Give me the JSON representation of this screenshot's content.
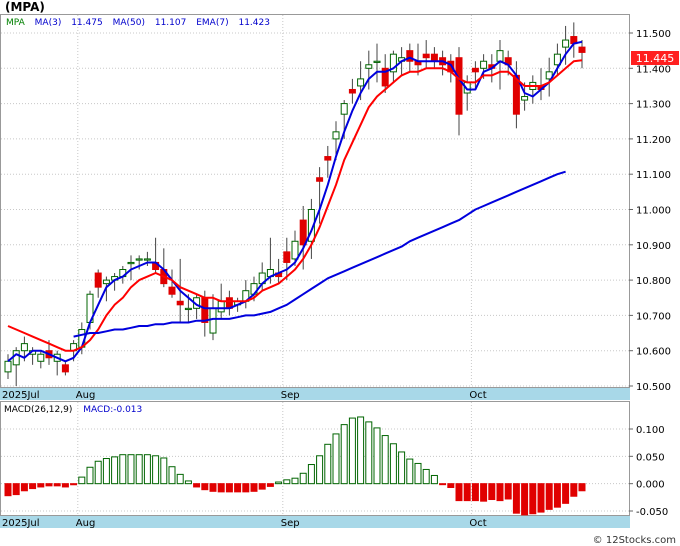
{
  "ticker_title": "(MPA)",
  "legend": {
    "symbol": "MPA",
    "ma3_label": "MA(3)",
    "ma3_value": "11.475",
    "ma50_label": "MA(50)",
    "ma50_value": "11.107",
    "ema7_label": "EMA(7)",
    "ema7_value": "11.423"
  },
  "price_badge": "11.445",
  "macd_legend": {
    "label": "MACD(26,12,9)",
    "value_text": "MACD:-0.013"
  },
  "watermark": "© 12Stocks.com",
  "colors": {
    "up": "#006400",
    "down": "#e00000",
    "ma3": "#0000dd",
    "ma50": "#0000dd",
    "ema7": "#ff0000",
    "axis_band": "#a8d8e8",
    "grid": "#c8c8c8",
    "badge_bg": "#ff2020",
    "legend_sym": "#008000",
    "legend_val": "#0000cc"
  },
  "chart_data": [
    {
      "type": "candlestick",
      "title": "(MPA)",
      "x_month_labels": [
        "2025Jul",
        "Aug",
        "Sep",
        "Oct"
      ],
      "x_month_label_index": [
        0,
        9,
        34,
        57
      ],
      "y_ticks": [
        "11.500",
        "11.400",
        "11.300",
        "11.200",
        "11.100",
        "11.000",
        "10.900",
        "10.800",
        "10.700",
        "10.600",
        "10.500"
      ],
      "ylim": [
        10.49,
        11.55
      ],
      "grid": true,
      "last_price": 11.445,
      "ohlc": [
        [
          10.54,
          10.59,
          10.52,
          10.57
        ],
        [
          10.56,
          10.61,
          10.5,
          10.6
        ],
        [
          10.6,
          10.64,
          10.57,
          10.62
        ],
        [
          10.59,
          10.61,
          10.56,
          10.6
        ],
        [
          10.57,
          10.6,
          10.55,
          10.59
        ],
        [
          10.6,
          10.63,
          10.56,
          10.58
        ],
        [
          10.57,
          10.6,
          10.53,
          10.59
        ],
        [
          10.56,
          10.57,
          10.53,
          10.54
        ],
        [
          10.6,
          10.63,
          10.57,
          10.62
        ],
        [
          10.61,
          10.68,
          10.59,
          10.66
        ],
        [
          10.68,
          10.77,
          10.66,
          10.76
        ],
        [
          10.82,
          10.83,
          10.75,
          10.78
        ],
        [
          10.79,
          10.81,
          10.74,
          10.8
        ],
        [
          10.8,
          10.82,
          10.77,
          10.81
        ],
        [
          10.81,
          10.84,
          10.79,
          10.83
        ],
        [
          10.85,
          10.87,
          10.8,
          10.85
        ],
        [
          10.86,
          10.87,
          10.83,
          10.86
        ],
        [
          10.86,
          10.88,
          10.84,
          10.86
        ],
        [
          10.85,
          10.92,
          10.82,
          10.83
        ],
        [
          10.83,
          10.89,
          10.78,
          10.79
        ],
        [
          10.78,
          10.83,
          10.75,
          10.76
        ],
        [
          10.74,
          10.86,
          10.68,
          10.73
        ],
        [
          10.72,
          10.76,
          10.68,
          10.72
        ],
        [
          10.72,
          10.76,
          10.69,
          10.75
        ],
        [
          10.75,
          10.77,
          10.64,
          10.68
        ],
        [
          10.65,
          10.76,
          10.63,
          10.72
        ],
        [
          10.71,
          10.79,
          10.69,
          10.74
        ],
        [
          10.75,
          10.77,
          10.7,
          10.72
        ],
        [
          10.73,
          10.75,
          10.71,
          10.74
        ],
        [
          10.74,
          10.8,
          10.72,
          10.77
        ],
        [
          10.76,
          10.81,
          10.74,
          10.79
        ],
        [
          10.79,
          10.85,
          10.77,
          10.82
        ],
        [
          10.81,
          10.92,
          10.79,
          10.83
        ],
        [
          10.82,
          10.86,
          10.79,
          10.81
        ],
        [
          10.88,
          10.92,
          10.8,
          10.85
        ],
        [
          10.86,
          10.94,
          10.84,
          10.91
        ],
        [
          10.97,
          11.01,
          10.83,
          10.9
        ],
        [
          10.91,
          11.03,
          10.86,
          11.0
        ],
        [
          11.09,
          11.12,
          10.96,
          11.08
        ],
        [
          11.15,
          11.18,
          11.09,
          11.14
        ],
        [
          11.2,
          11.25,
          11.14,
          11.22
        ],
        [
          11.27,
          11.31,
          11.2,
          11.3
        ],
        [
          11.34,
          11.37,
          11.3,
          11.33
        ],
        [
          11.35,
          11.42,
          11.31,
          11.37
        ],
        [
          11.4,
          11.45,
          11.34,
          11.41
        ],
        [
          11.42,
          11.47,
          11.36,
          11.42
        ],
        [
          11.4,
          11.44,
          11.33,
          11.35
        ],
        [
          11.39,
          11.45,
          11.36,
          11.44
        ],
        [
          11.42,
          11.46,
          11.38,
          11.43
        ],
        [
          11.45,
          11.47,
          11.39,
          11.42
        ],
        [
          11.42,
          11.47,
          11.38,
          11.41
        ],
        [
          11.44,
          11.48,
          11.4,
          11.43
        ],
        [
          11.44,
          11.46,
          11.4,
          11.42
        ],
        [
          11.43,
          11.45,
          11.38,
          11.41
        ],
        [
          11.42,
          11.44,
          11.36,
          11.39
        ],
        [
          11.43,
          11.46,
          11.21,
          11.27
        ],
        [
          11.33,
          11.38,
          11.28,
          11.36
        ],
        [
          11.4,
          11.42,
          11.34,
          11.39
        ],
        [
          11.4,
          11.44,
          11.37,
          11.42
        ],
        [
          11.41,
          11.44,
          11.36,
          11.4
        ],
        [
          11.42,
          11.48,
          11.34,
          11.45
        ],
        [
          11.43,
          11.45,
          11.38,
          11.41
        ],
        [
          11.38,
          11.42,
          11.23,
          11.27
        ],
        [
          11.31,
          11.36,
          11.28,
          11.32
        ],
        [
          11.34,
          11.38,
          11.3,
          11.36
        ],
        [
          11.35,
          11.4,
          11.31,
          11.34
        ],
        [
          11.37,
          11.43,
          11.32,
          11.39
        ],
        [
          11.41,
          11.47,
          11.38,
          11.44
        ],
        [
          11.46,
          11.52,
          11.41,
          11.48
        ],
        [
          11.49,
          11.53,
          11.43,
          11.47
        ],
        [
          11.46,
          11.48,
          11.4,
          11.445
        ]
      ],
      "series": [
        {
          "name": "MA(3)",
          "values": [
            10.57,
            10.59,
            10.58,
            10.6,
            10.6,
            10.59,
            10.58,
            10.57,
            10.58,
            10.61,
            10.68,
            10.73,
            10.78,
            10.8,
            10.81,
            10.83,
            10.84,
            10.85,
            10.85,
            10.83,
            10.8,
            10.77,
            10.75,
            10.73,
            10.72,
            10.72,
            10.72,
            10.72,
            10.73,
            10.74,
            10.76,
            10.79,
            10.81,
            10.82,
            10.83,
            10.85,
            10.89,
            10.94,
            11.0,
            11.07,
            11.15,
            11.22,
            11.28,
            11.33,
            11.37,
            11.39,
            11.39,
            11.4,
            11.42,
            11.43,
            11.42,
            11.42,
            11.42,
            11.42,
            11.41,
            11.37,
            11.34,
            11.34,
            11.39,
            11.4,
            11.42,
            11.41,
            11.38,
            11.33,
            11.32,
            11.34,
            11.36,
            11.4,
            11.44,
            11.47,
            11.475
          ]
        },
        {
          "name": "EMA(7)",
          "values": [
            10.67,
            10.66,
            10.65,
            10.64,
            10.63,
            10.62,
            10.61,
            10.6,
            10.6,
            10.61,
            10.63,
            10.66,
            10.7,
            10.73,
            10.75,
            10.78,
            10.8,
            10.81,
            10.82,
            10.81,
            10.8,
            10.78,
            10.77,
            10.76,
            10.75,
            10.75,
            10.74,
            10.74,
            10.74,
            10.74,
            10.75,
            10.77,
            10.78,
            10.79,
            10.81,
            10.83,
            10.86,
            10.9,
            10.95,
            11.01,
            11.07,
            11.14,
            11.19,
            11.24,
            11.29,
            11.32,
            11.34,
            11.36,
            11.38,
            11.39,
            11.39,
            11.4,
            11.4,
            11.4,
            11.39,
            11.37,
            11.36,
            11.36,
            11.38,
            11.38,
            11.39,
            11.39,
            11.37,
            11.35,
            11.35,
            11.35,
            11.36,
            11.38,
            11.4,
            11.42,
            11.423
          ]
        },
        {
          "name": "MA(50)",
          "values": [
            null,
            null,
            null,
            null,
            null,
            null,
            null,
            null,
            10.64,
            10.645,
            10.65,
            10.65,
            10.655,
            10.66,
            10.66,
            10.665,
            10.67,
            10.67,
            10.675,
            10.675,
            10.68,
            10.68,
            10.68,
            10.685,
            10.685,
            10.69,
            10.69,
            10.69,
            10.695,
            10.7,
            10.7,
            10.705,
            10.71,
            10.72,
            10.73,
            10.745,
            10.76,
            10.775,
            10.79,
            10.805,
            10.815,
            10.825,
            10.835,
            10.845,
            10.855,
            10.865,
            10.875,
            10.885,
            10.895,
            10.91,
            10.92,
            10.93,
            10.94,
            10.95,
            10.96,
            10.97,
            10.985,
            11.0,
            11.01,
            11.02,
            11.03,
            11.04,
            11.05,
            11.06,
            11.07,
            11.08,
            11.09,
            11.1,
            11.107,
            null,
            null
          ]
        }
      ]
    },
    {
      "type": "bar",
      "title": "MACD(26,12,9)",
      "y_ticks": [
        "0.100",
        "0.050",
        "0.000",
        "-0.050"
      ],
      "ylim": [
        -0.058,
        0.14
      ],
      "x_month_labels": [
        "2025Jul",
        "Aug",
        "Sep",
        "Oct"
      ],
      "values": [
        -0.022,
        -0.02,
        -0.013,
        -0.009,
        -0.006,
        -0.004,
        -0.004,
        -0.006,
        -0.002,
        0.012,
        0.03,
        0.041,
        0.046,
        0.049,
        0.053,
        0.053,
        0.053,
        0.053,
        0.051,
        0.047,
        0.031,
        0.017,
        0.005,
        -0.006,
        -0.011,
        -0.014,
        -0.015,
        -0.015,
        -0.015,
        -0.015,
        -0.014,
        -0.01,
        -0.005,
        0.003,
        0.007,
        0.01,
        0.019,
        0.035,
        0.051,
        0.072,
        0.091,
        0.108,
        0.12,
        0.122,
        0.113,
        0.102,
        0.088,
        0.073,
        0.058,
        0.045,
        0.037,
        0.026,
        0.015,
        -0.001,
        -0.007,
        -0.031,
        -0.031,
        -0.031,
        -0.032,
        -0.029,
        -0.031,
        -0.028,
        -0.054,
        -0.057,
        -0.055,
        -0.052,
        -0.047,
        -0.043,
        -0.036,
        -0.023,
        -0.013
      ]
    }
  ]
}
